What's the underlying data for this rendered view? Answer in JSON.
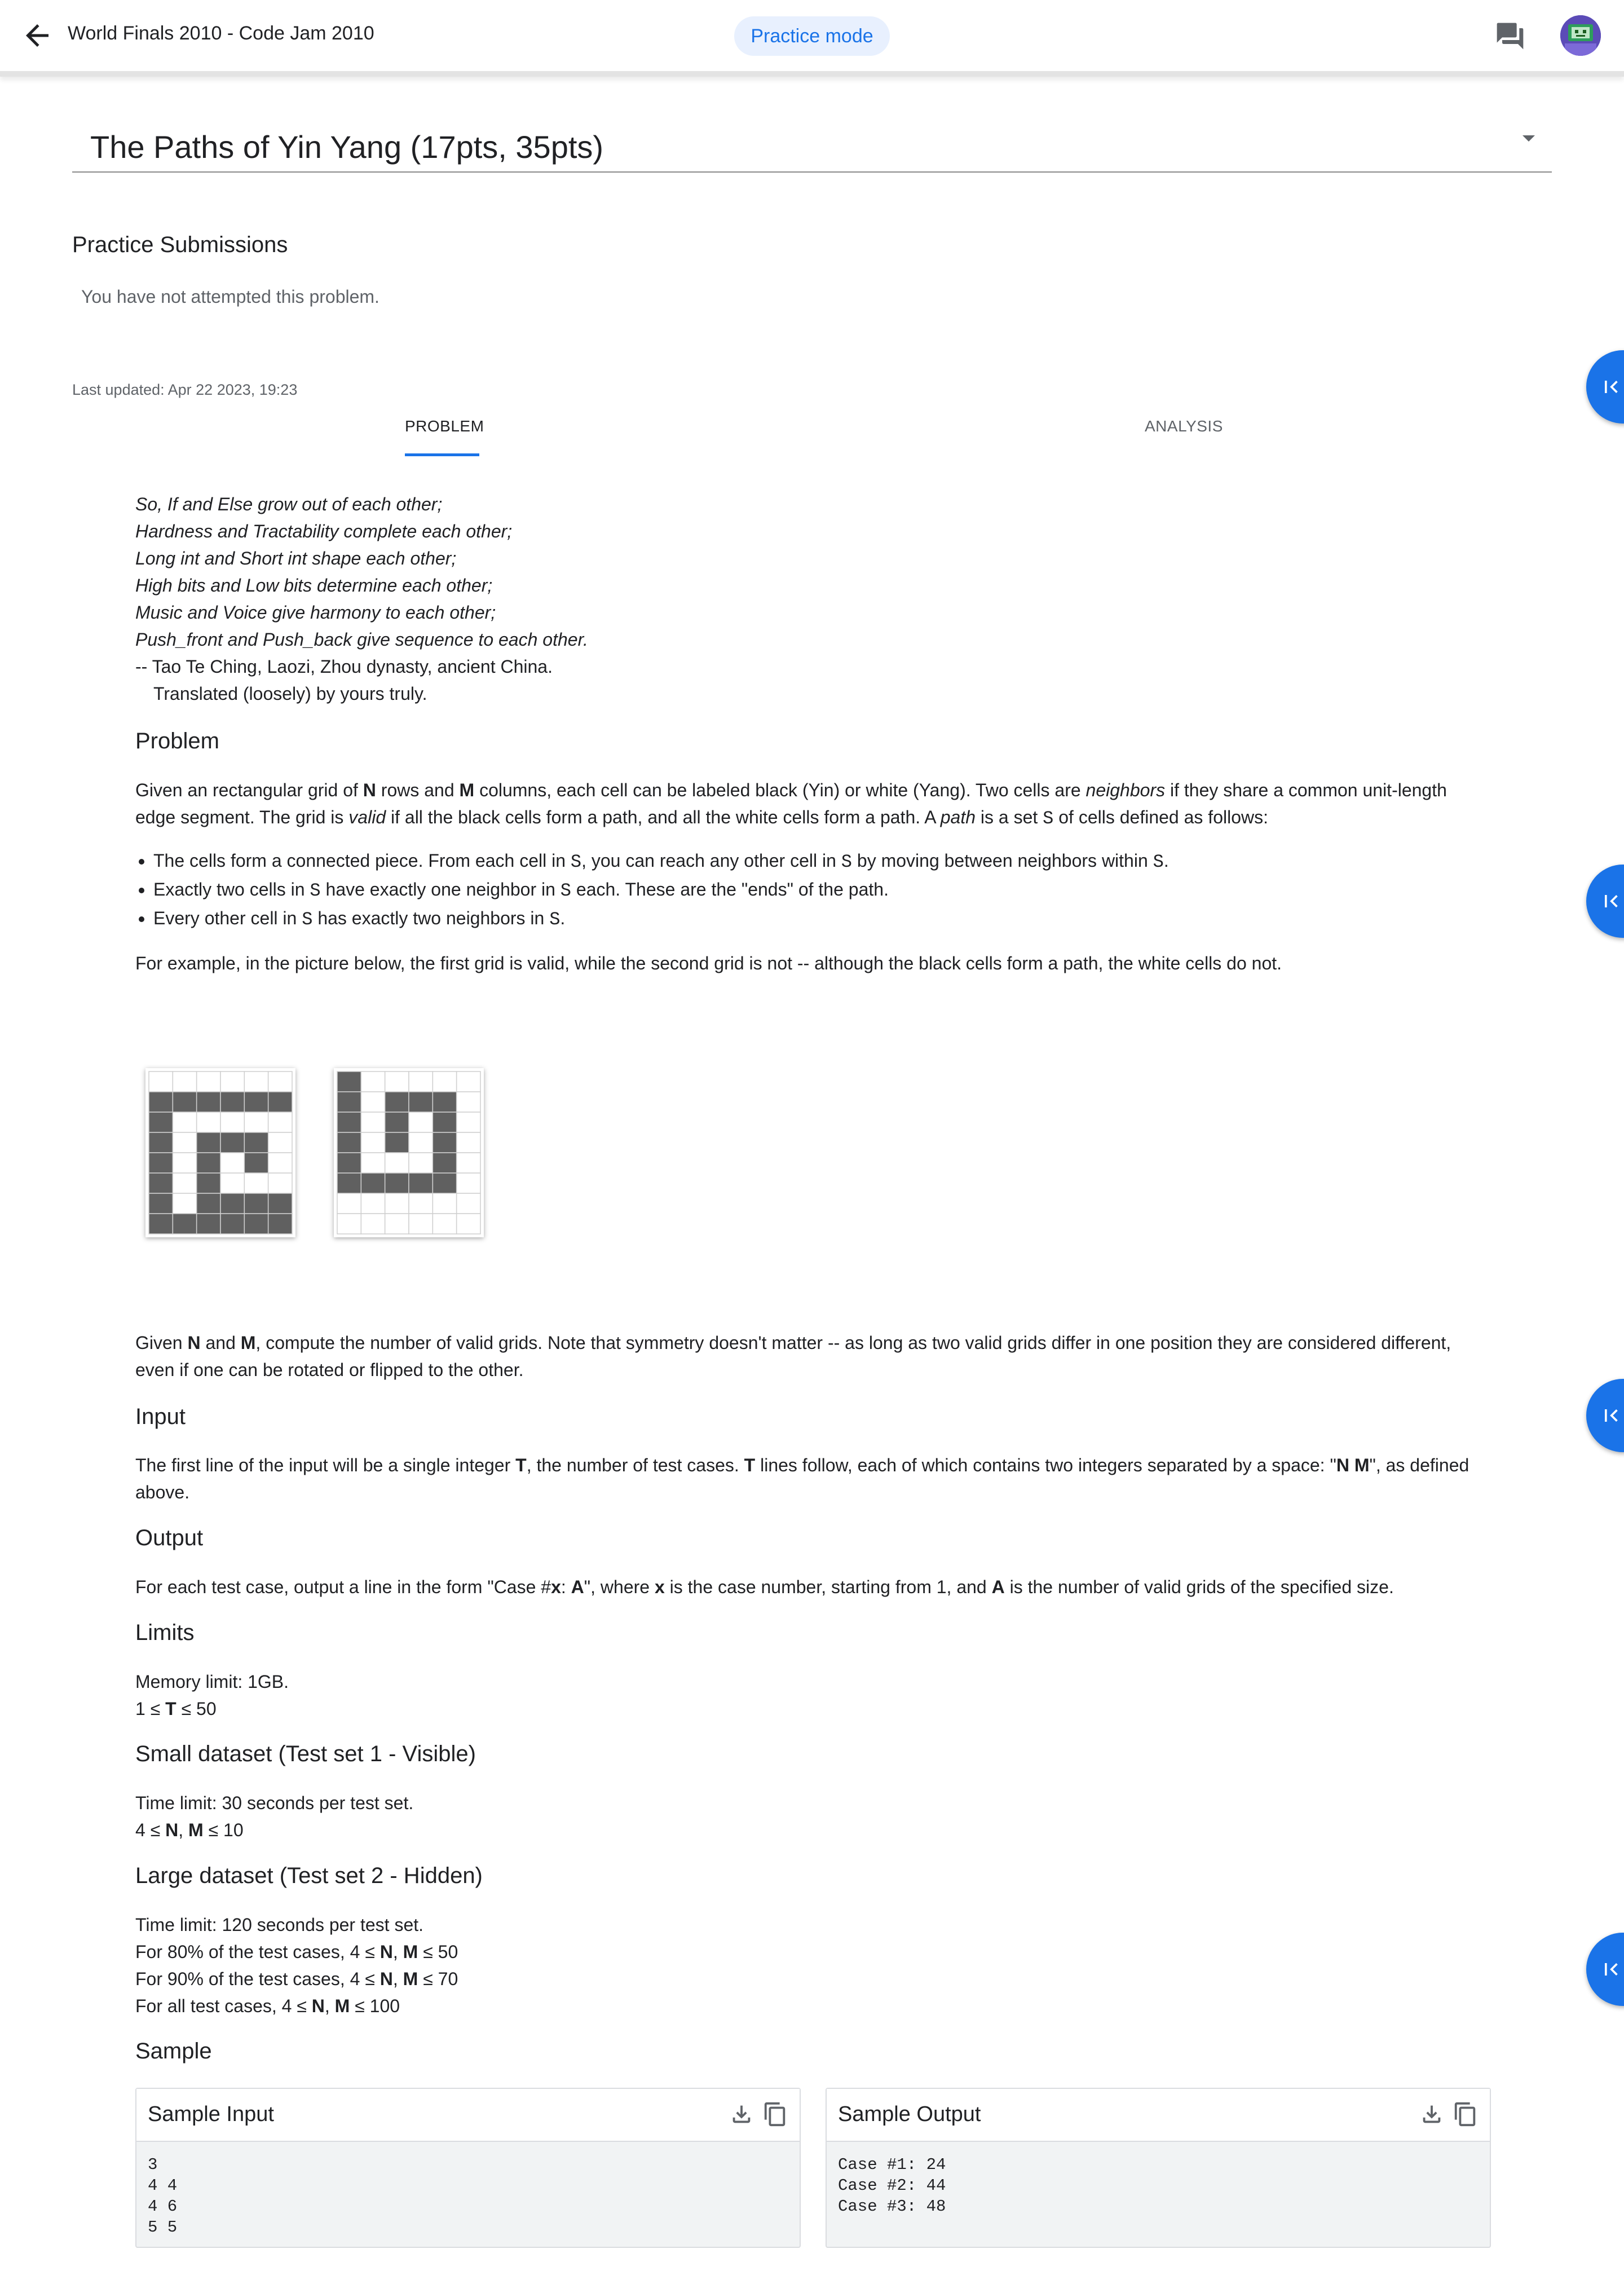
{
  "header": {
    "title": "World Finals 2010 - Code Jam 2010",
    "mode_pill": "Practice mode"
  },
  "problem_selector": {
    "selected": "The Paths of Yin Yang (17pts, 35pts)"
  },
  "submissions": {
    "heading": "Practice Submissions",
    "status": "You have not attempted this problem."
  },
  "last_updated": "Last updated: Apr 22 2023, 19:23",
  "tabs": [
    {
      "label": "PROBLEM",
      "active": true
    },
    {
      "label": "ANALYSIS",
      "active": false
    }
  ],
  "poem": {
    "lines": [
      "So, If and Else grow out of each other;",
      "Hardness and Tractability complete each other;",
      "Long int and Short int shape each other;",
      "High bits and Low bits determine each other;",
      "Music and Voice give harmony to each other;",
      "Push_front and Push_back give sequence to each other."
    ],
    "attribution": "-- Tao Te Ching, Laozi, Zhou dynasty, ancient China.",
    "translation": "Translated (loosely) by yours truly."
  },
  "statement": {
    "problem_heading": "Problem",
    "intro": {
      "t1": "Given an rectangular grid of ",
      "n": "N",
      "t2": " rows and ",
      "m": "M",
      "t3": " columns, each cell can be labeled black (Yin) or white (Yang). Two cells are ",
      "neighbors": "neighbors",
      "t4": " if they share a common unit-length edge segment. The grid is ",
      "valid": "valid",
      "t5": " if all the black cells form a path, and all the white cells form a path. A ",
      "path": "path",
      "t6": " is a set ",
      "s": "S",
      "t7": " of cells defined as follows:"
    },
    "bullets": [
      {
        "a": "The cells form a connected piece. From each cell in ",
        "s1": "S",
        "b": ", you can reach any other cell in ",
        "s2": "S",
        "c": " by moving between neighbors within ",
        "s3": "S",
        "d": "."
      },
      {
        "a": "Exactly two cells in ",
        "s1": "S",
        "b": " have exactly one neighbor in ",
        "s2": "S",
        "c": " each. These are the \"ends\" of the path."
      },
      {
        "a": "Every other cell in ",
        "s1": "S",
        "b": " has exactly two neighbors in ",
        "s2": "S",
        "c": "."
      }
    ],
    "example": "For example, in the picture below, the first grid is valid, while the second grid is not -- although the black cells form a path, the white cells do not.",
    "count": {
      "t1": "Given ",
      "n": "N",
      "t2": " and ",
      "m": "M",
      "t3": ", compute the number of valid grids. Note that symmetry doesn't matter -- as long as two valid grids differ in one position they are considered different, even if one can be rotated or flipped to the other."
    },
    "input_heading": "Input",
    "input": {
      "t1": "The first line of the input will be a single integer ",
      "T": "T",
      "t2": ", the number of test cases. ",
      "T2": "T",
      "t3": " lines follow, each of which contains two integers separated by a space: \"",
      "nm": "N M",
      "t4": "\", as defined above."
    },
    "output_heading": "Output",
    "output": {
      "t1": "For each test case, output a line in the form \"Case #",
      "x": "x",
      "t2": ": ",
      "A": "A",
      "t3": "\", where ",
      "x2": "x",
      "t4": " is the case number, starting from 1, and ",
      "A2": "A",
      "t5": " is the number of valid grids of the specified size."
    },
    "limits_heading": "Limits",
    "limits": {
      "memory": "Memory limit: 1GB.",
      "t_pre": "1 ≤ ",
      "T": "T",
      "t_post": " ≤ 50"
    },
    "small_heading": "Small dataset (Test set 1 - Visible)",
    "small": {
      "time": "Time limit: 30 seconds per test set.",
      "pre": "4 ≤ ",
      "n": "N",
      "comma": ", ",
      "m": "M",
      "post": " ≤ 10"
    },
    "large_heading": "Large dataset (Test set 2 - Hidden)",
    "large": {
      "time": "Time limit: 120 seconds per test set.",
      "lines": [
        {
          "pre": "For 80% of the test cases, 4 ≤ ",
          "n": "N",
          "comma": ", ",
          "m": "M",
          "post": " ≤ 50"
        },
        {
          "pre": "For 90% of the test cases, 4 ≤ ",
          "n": "N",
          "comma": ", ",
          "m": "M",
          "post": " ≤ 70"
        },
        {
          "pre": "For all test cases, 4 ≤ ",
          "n": "N",
          "comma": ", ",
          "m": "M",
          "post": " ≤ 100"
        }
      ]
    },
    "sample_heading": "Sample"
  },
  "sample_input": {
    "title": "Sample Input",
    "body": "3\n4 4\n4 6\n5 5"
  },
  "sample_output": {
    "title": "Sample Output",
    "body": "Case #1: 24\nCase #2: 44\nCase #3: 48"
  },
  "grids": [
    {
      "rows": [
        "......",
        "######",
        "#.....",
        "#.###.",
        "#.#.#.",
        "#.#...",
        "#.####",
        "######"
      ]
    },
    {
      "rows": [
        "#.....",
        "#.###.",
        "#.#.#.",
        "#.#.#.",
        "#...#.",
        "#####.",
        "......",
        "......"
      ]
    }
  ],
  "colors": {
    "accent": "#1a73e8",
    "pill_bg": "#e8f0fe",
    "grid_dark": "#606060",
    "grid_light": "#ffffff"
  },
  "icons": {
    "back": "arrow-back-icon",
    "chat": "chat-icon",
    "collapse": "first-page-icon",
    "download": "download-icon",
    "copy": "copy-icon"
  }
}
